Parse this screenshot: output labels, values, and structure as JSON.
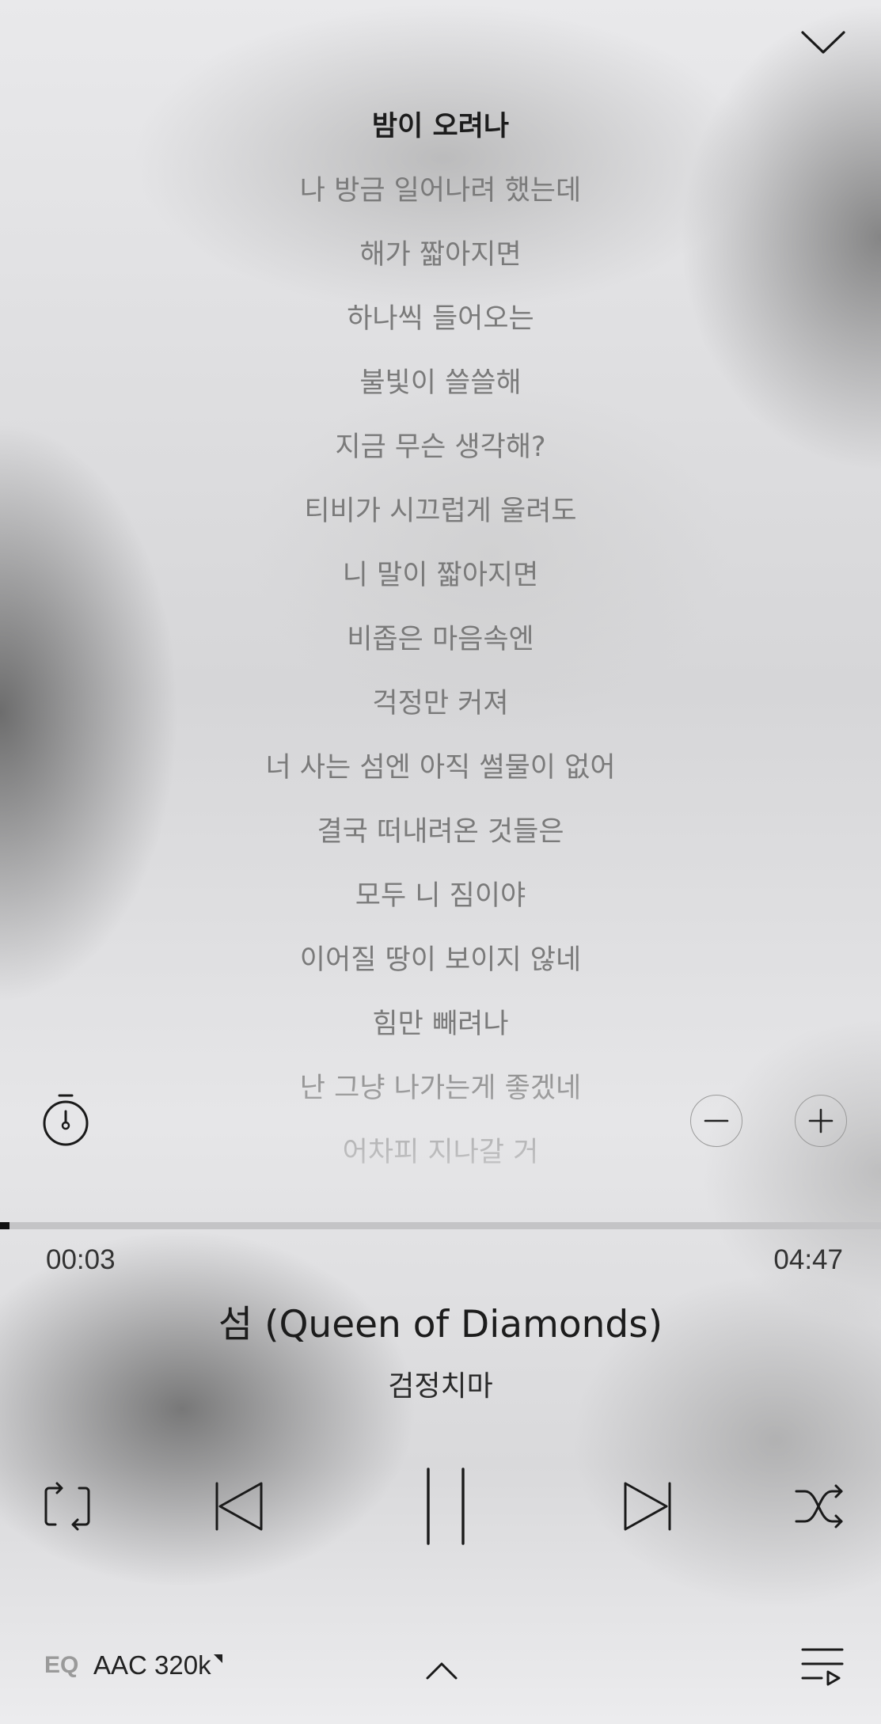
{
  "player": {
    "lyrics": [
      {
        "text": "밤이 오려나",
        "current": true
      },
      {
        "text": "나 방금 일어나려 했는데",
        "current": false
      },
      {
        "text": "해가 짧아지면",
        "current": false
      },
      {
        "text": "하나씩 들어오는",
        "current": false
      },
      {
        "text": "불빛이 쓸쓸해",
        "current": false
      },
      {
        "text": "지금 무슨 생각해?",
        "current": false
      },
      {
        "text": "티비가 시끄럽게 울려도",
        "current": false
      },
      {
        "text": "니 말이 짧아지면",
        "current": false
      },
      {
        "text": "비좁은 마음속엔",
        "current": false
      },
      {
        "text": "걱정만 커져",
        "current": false
      },
      {
        "text": "너 사는 섬엔 아직 썰물이 없어",
        "current": false
      },
      {
        "text": "결국 떠내려온 것들은",
        "current": false
      },
      {
        "text": "모두 니 짐이야",
        "current": false
      },
      {
        "text": "이어질 땅이 보이지 않네",
        "current": false
      },
      {
        "text": "힘만 빼려나",
        "current": false
      },
      {
        "text": "난 그냥 나가는게 좋겠네",
        "current": false
      },
      {
        "text": "어차피 지나갈 거",
        "current": false
      }
    ],
    "progress": {
      "elapsed": "00:03",
      "total": "04:47",
      "fraction": 0.0105
    },
    "track": {
      "title": "섬 (Queen of Diamonds)",
      "artist": "검정치마"
    },
    "bottom_bar": {
      "eq_label": "EQ",
      "quality_label": "AAC 320k"
    },
    "icons": {
      "collapse": "chevron-down-icon",
      "timer": "sleep-timer-icon",
      "zoom_out": "minus-icon",
      "zoom_in": "plus-icon",
      "repeat": "repeat-icon",
      "previous": "skip-previous-icon",
      "pause": "pause-icon",
      "next": "skip-next-icon",
      "shuffle": "shuffle-icon",
      "expand": "chevron-up-icon",
      "queue": "queue-icon"
    },
    "colors": {
      "current_lyric": "#1c1c1c",
      "other_lyric": "#7a7a7a",
      "progress_fill": "#111111",
      "progress_track": "#c4c4c6"
    }
  }
}
